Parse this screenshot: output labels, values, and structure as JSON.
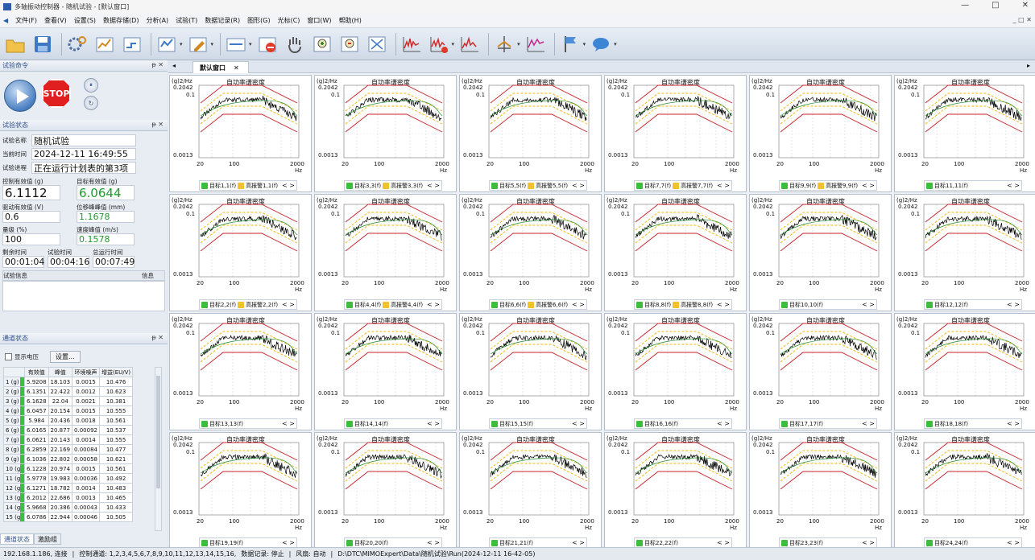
{
  "window": {
    "title": "多轴振动控制器 - 随机试验 - [默认窗口]",
    "controls": [
      "—",
      "□",
      "✕"
    ]
  },
  "menu": {
    "items": [
      "文件(F)",
      "查看(V)",
      "设置(S)",
      "数据存储(D)",
      "分析(A)",
      "试验(T)",
      "数据记录(R)",
      "图形(G)",
      "光标(C)",
      "窗口(W)",
      "帮助(H)"
    ],
    "mdi_controls": "_ □ ✕"
  },
  "toolbar": {
    "icons": [
      "open-folder-icon",
      "save-icon",
      "settings-gears-icon",
      "profile-edit-icon",
      "channel-icon",
      "graph-dropdown-icon",
      "edit-chart-icon",
      "view-icon",
      "no-graph-icon",
      "hand-pan-icon",
      "zoom-in-icon",
      "zoom-out-icon",
      "fit-icon",
      "spectrum-icon",
      "spectrum-red-icon",
      "spectrum-alt-icon",
      "cursor-icon",
      "line-icon",
      "flag-icon",
      "chat-icon"
    ]
  },
  "panels": {
    "command_title": "试验命令",
    "status_title": "试验状态",
    "channel_title": "通道状态",
    "stop_label": "STOP"
  },
  "status": {
    "test_name_label": "试验名称",
    "test_name": "随机试验",
    "time_label": "当前时间",
    "time": "2024-12-11 16:49:55",
    "progress_label": "试验进程",
    "progress": "正在运行计划表的第3项",
    "ctrl_rms_label": "控制有效值 (g)",
    "ctrl_rms": "6.1112",
    "target_rms_label": "目标有效值 (g)",
    "target_rms": "6.0644",
    "drive_rms_label": "驱动有效值 (V)",
    "drive_rms": "0.6",
    "disp_peak_label": "位移峰峰值 (mm)",
    "disp_peak": "1.1678",
    "level_label": "量级 (%)",
    "level": "100",
    "vel_peak_label": "速度峰值 (m/s)",
    "vel_peak": "0.1578",
    "remain_label": "剩余时间",
    "remain": "00:01:04",
    "test_time_label": "试验时间",
    "test_time": "00:04:16",
    "total_label": "总运行时间",
    "total": "00:07:49",
    "info_label": "试验信息",
    "info_btn": "信息"
  },
  "channels": {
    "show_voltage": "显示电压",
    "settings_btn": "设置...",
    "headers": [
      "有效值",
      "峰值",
      "环境噪声",
      "增益(EU/V)"
    ],
    "rows": [
      [
        "1 (g)",
        "5.9208",
        "18.103",
        "0.0015",
        "10.476"
      ],
      [
        "2 (g)",
        "6.1351",
        "22.422",
        "0.0012",
        "10.623"
      ],
      [
        "3 (g)",
        "6.1628",
        "22.04",
        "0.0021",
        "10.381"
      ],
      [
        "4 (g)",
        "6.0457",
        "20.154",
        "0.0015",
        "10.555"
      ],
      [
        "5 (g)",
        "5.984",
        "20.436",
        "0.0018",
        "10.561"
      ],
      [
        "6 (g)",
        "6.0165",
        "20.877",
        "0.00092",
        "10.537"
      ],
      [
        "7 (g)",
        "6.0621",
        "20.143",
        "0.0014",
        "10.555"
      ],
      [
        "8 (g)",
        "6.2859",
        "22.169",
        "0.00084",
        "10.477"
      ],
      [
        "9 (g)",
        "6.1036",
        "22.802",
        "0.00058",
        "10.621"
      ],
      [
        "10 (g)",
        "6.1228",
        "20.974",
        "0.0015",
        "10.561"
      ],
      [
        "11 (g)",
        "5.9778",
        "19.983",
        "0.00036",
        "10.492"
      ],
      [
        "12 (g)",
        "6.1271",
        "18.782",
        "0.0014",
        "10.483"
      ],
      [
        "13 (g)",
        "6.2012",
        "22.686",
        "0.0013",
        "10.465"
      ],
      [
        "14 (g)",
        "5.9668",
        "20.386",
        "0.00043",
        "10.433"
      ],
      [
        "15 (g)",
        "6.0786",
        "22.944",
        "0.00046",
        "10.505"
      ]
    ],
    "tabs": [
      "通道状态",
      "激励组"
    ]
  },
  "doc": {
    "tab": "默认窗口"
  },
  "plot_common": {
    "ylabel": "(g)2/Hz",
    "title": "自功率谱密度",
    "ytop": "0.2042",
    "ymid": "0.1",
    "ybot": "0.0013",
    "xticks": [
      "20",
      "100",
      "2000"
    ],
    "xunit": "Hz"
  },
  "plots": [
    {
      "target": "目标1,1(f)",
      "alarm": "高报警1,1(f)"
    },
    {
      "target": "目标3,3(f)",
      "alarm": "高报警3,3(f)"
    },
    {
      "target": "目标5,5(f)",
      "alarm": "高报警5,5(f)"
    },
    {
      "target": "目标7,7(f)",
      "alarm": "高报警7,7(f)"
    },
    {
      "target": "目标9,9(f)",
      "alarm": "高报警9,9(f)"
    },
    {
      "target": "目标11,11(f)",
      "alarm": ""
    },
    {
      "target": "目标2,2(f)",
      "alarm": "高报警2,2(f)"
    },
    {
      "target": "目标4,4(f)",
      "alarm": "高报警4,4(f)"
    },
    {
      "target": "目标6,6(f)",
      "alarm": "高报警6,6(f)"
    },
    {
      "target": "目标8,8(f)",
      "alarm": "高报警8,8(f)"
    },
    {
      "target": "目标10,10(f)",
      "alarm": ""
    },
    {
      "target": "目标12,12(f)",
      "alarm": ""
    },
    {
      "target": "目标13,13(f)",
      "alarm": ""
    },
    {
      "target": "目标14,14(f)",
      "alarm": ""
    },
    {
      "target": "目标15,15(f)",
      "alarm": ""
    },
    {
      "target": "目标16,16(f)",
      "alarm": ""
    },
    {
      "target": "目标17,17(f)",
      "alarm": ""
    },
    {
      "target": "目标18,18(f)",
      "alarm": ""
    },
    {
      "target": "目标19,19(f)",
      "alarm": ""
    },
    {
      "target": "目标20,20(f)",
      "alarm": ""
    },
    {
      "target": "目标21,21(f)",
      "alarm": ""
    },
    {
      "target": "目标22,22(f)",
      "alarm": ""
    },
    {
      "target": "目标23,23(f)",
      "alarm": ""
    },
    {
      "target": "目标24,24(f)",
      "alarm": ""
    }
  ],
  "statusbar": {
    "ip": "192.168.1.186, 连接",
    "channels": "控制通道: 1,2,3,4,5,6,7,8,9,10,11,12,13,14,15,16,",
    "record": "数据记录: 停止",
    "wind": "风扇: 自动",
    "path": "D:\\DTC\\MIMOExpert\\Data\\随机试验\\Run(2024-12-11 16-42-05)"
  }
}
